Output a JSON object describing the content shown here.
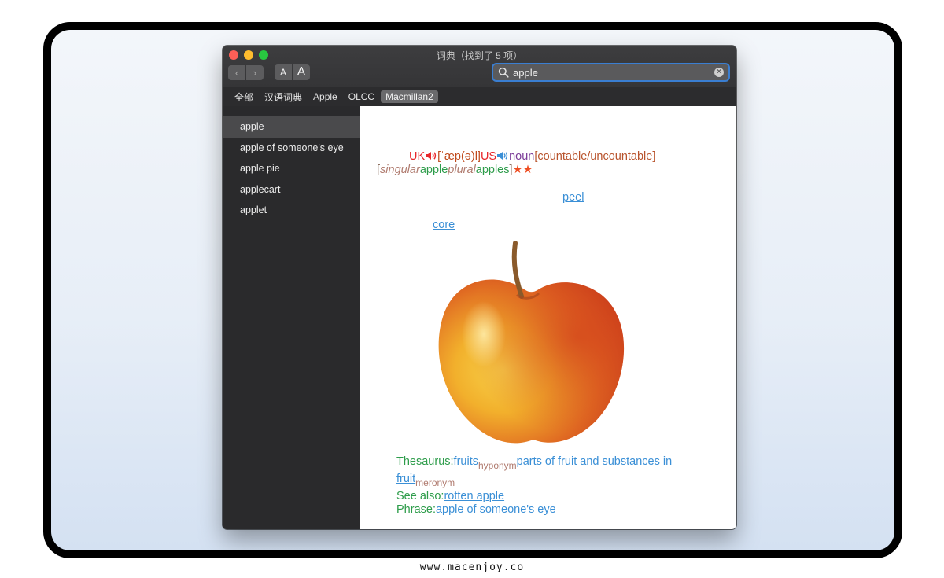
{
  "window": {
    "title": "词典（找到了 5 项）"
  },
  "toolbar": {
    "back_label": "‹",
    "forward_label": "›",
    "font_smaller_label": "A",
    "font_larger_label": "A",
    "search_value": "apple"
  },
  "tabs": [
    {
      "label": "全部",
      "selected": false
    },
    {
      "label": "汉语词典",
      "selected": false
    },
    {
      "label": "Apple",
      "selected": false
    },
    {
      "label": "OLCC",
      "selected": false
    },
    {
      "label": "Macmillan2",
      "selected": true
    }
  ],
  "sidebar": {
    "items": [
      {
        "label": "apple",
        "selected": true
      },
      {
        "label": "apple of someone's eye"
      },
      {
        "label": "apple pie"
      },
      {
        "label": "applecart"
      },
      {
        "label": "applet"
      }
    ]
  },
  "entry": {
    "uk": "UK",
    "ipa": "[ˈæp(ə)l]",
    "us": "US",
    "pos": "noun",
    "grammar": "[countable/uncountable]",
    "bracket_open": "[",
    "singular_label": "singular",
    "singular_form": "apple",
    "plural_label": "plural",
    "plural_form": "apples",
    "bracket_close": "]",
    "stars": "★★",
    "peel": "peel",
    "core": "core",
    "thesaurus_label": "Thesaurus:",
    "thesaurus_link1": "fruits",
    "hyponym": "hyponym",
    "thesaurus_link2": "parts of fruit and substances in fruit",
    "meronym": "meronym",
    "see_also_label": "See also:",
    "see_also_link": "rotten apple",
    "phrase_label": "Phrase:",
    "phrase_link": "apple of someone's eye"
  },
  "footer": {
    "watermark": "www.macenjoy.co"
  },
  "colors": {
    "accent": "#3a7ed1",
    "link": "#3a8fd6",
    "green": "#2d9c4a",
    "red": "#e8262a"
  }
}
